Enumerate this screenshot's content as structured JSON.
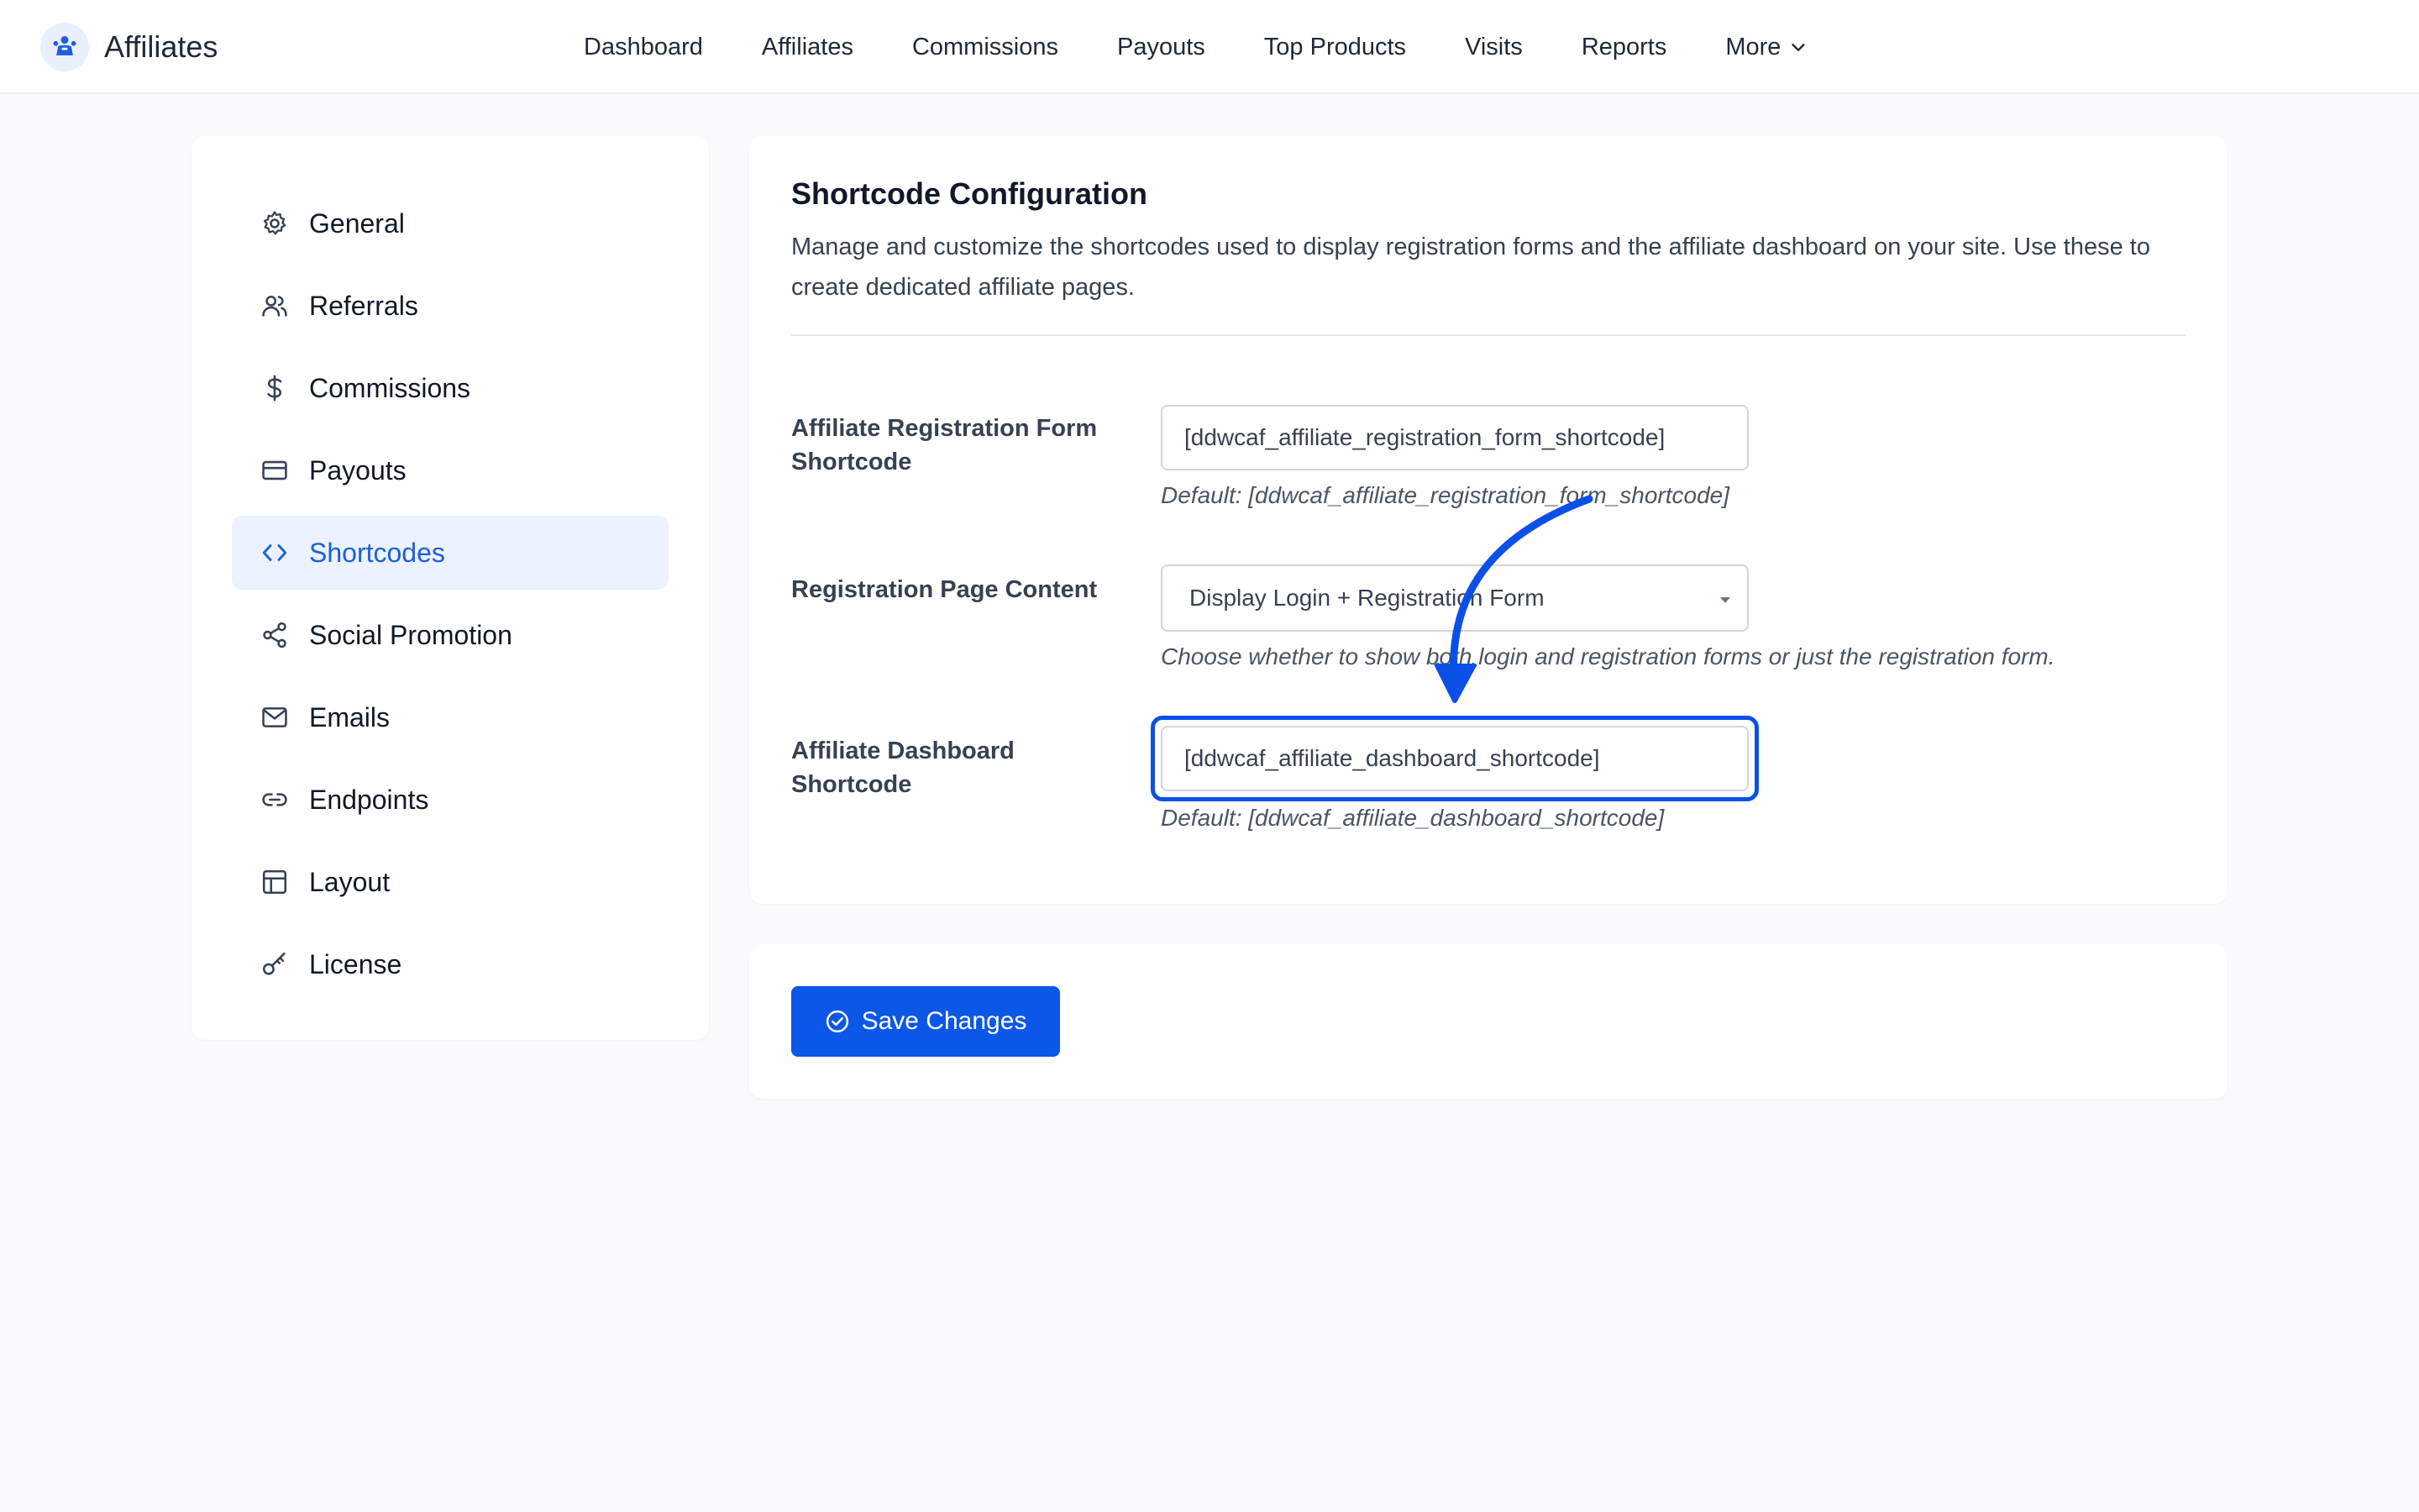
{
  "app": {
    "name": "Affiliates",
    "logo_icon": "affiliate-people-icon",
    "accent_color": "#0b57e8"
  },
  "topnav": {
    "items": [
      {
        "label": "Dashboard"
      },
      {
        "label": "Affiliates"
      },
      {
        "label": "Commissions"
      },
      {
        "label": "Payouts"
      },
      {
        "label": "Top Products"
      },
      {
        "label": "Visits"
      },
      {
        "label": "Reports"
      },
      {
        "label": "More",
        "icon": "chevron-down-icon"
      }
    ]
  },
  "sidebar": {
    "active": "Shortcodes",
    "items": [
      {
        "label": "General",
        "icon": "gear-icon"
      },
      {
        "label": "Referrals",
        "icon": "users-icon"
      },
      {
        "label": "Commissions",
        "icon": "dollar-icon"
      },
      {
        "label": "Payouts",
        "icon": "credit-card-icon"
      },
      {
        "label": "Shortcodes",
        "icon": "code-icon"
      },
      {
        "label": "Social Promotion",
        "icon": "share-icon"
      },
      {
        "label": "Emails",
        "icon": "mail-icon"
      },
      {
        "label": "Endpoints",
        "icon": "link-icon"
      },
      {
        "label": "Layout",
        "icon": "layout-icon"
      },
      {
        "label": "License",
        "icon": "key-icon"
      }
    ]
  },
  "main": {
    "title": "Shortcode Configuration",
    "description": "Manage and customize the shortcodes used to display registration forms and the affiliate dashboard on your site. Use these to create dedicated affiliate pages.",
    "fields": {
      "registration_form": {
        "label": "Affiliate Registration Form Shortcode",
        "value": "[ddwcaf_affiliate_registration_form_shortcode]",
        "help": "Default: [ddwcaf_affiliate_registration_form_shortcode]"
      },
      "registration_content": {
        "label": "Registration Page Content",
        "selected": "Display Login + Registration Form",
        "help": "Choose whether to show both login and registration forms or just the registration form."
      },
      "dashboard": {
        "label": "Affiliate Dashboard Shortcode",
        "value": "[ddwcaf_affiliate_dashboard_shortcode]",
        "help": "Default: [ddwcaf_affiliate_dashboard_shortcode]"
      }
    },
    "annotation_color": "#0a50e6"
  },
  "actions": {
    "save_label": "Save Changes",
    "save_icon": "check-circle-icon"
  }
}
